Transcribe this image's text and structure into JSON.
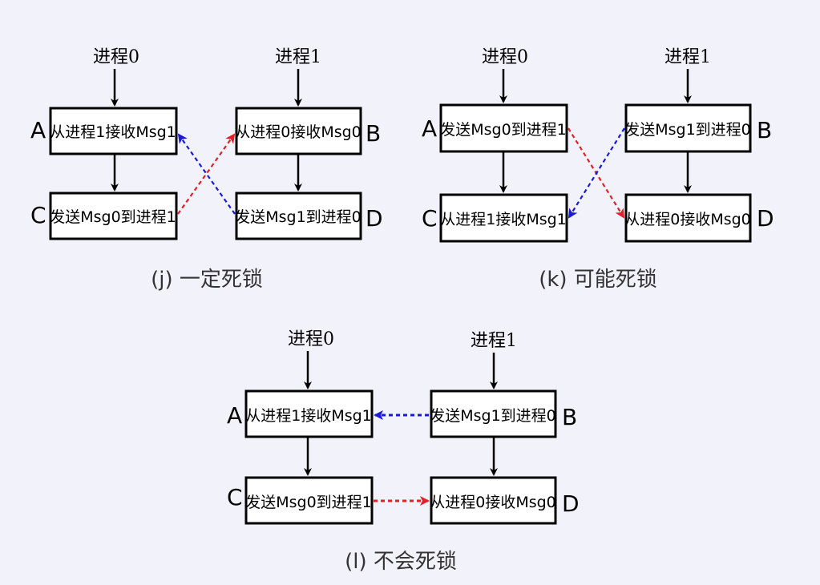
{
  "panel_j": {
    "caption": "(j) 一定死锁",
    "proc0": "进程0",
    "proc1": "进程1",
    "box_a": "从进程1接收Msg1",
    "box_b": "从进程0接收Msg0",
    "box_c": "发送Msg0到进程1",
    "box_d": "发送Msg1到进程0",
    "letter_a": "A",
    "letter_b": "B",
    "letter_c": "C",
    "letter_d": "D"
  },
  "panel_k": {
    "caption": "(k) 可能死锁",
    "proc0": "进程0",
    "proc1": "进程1",
    "box_a": "发送Msg0到进程1",
    "box_b": "发送Msg1到进程0",
    "box_c": "从进程1接收Msg1",
    "box_d": "从进程0接收Msg0",
    "letter_a": "A",
    "letter_b": "B",
    "letter_c": "C",
    "letter_d": "D"
  },
  "panel_l": {
    "caption": "(l) 不会死锁",
    "proc0": "进程0",
    "proc1": "进程1",
    "box_a": "从进程1接收Msg1",
    "box_b": "发送Msg1到进程0",
    "box_c": "发送Msg0到进程1",
    "box_d": "从进程0接收Msg0",
    "letter_a": "A",
    "letter_b": "B",
    "letter_c": "C",
    "letter_d": "D"
  },
  "colors": {
    "background": "#f2f2fb",
    "red_message": "#e0202a",
    "blue_message": "#1a1ad6"
  }
}
